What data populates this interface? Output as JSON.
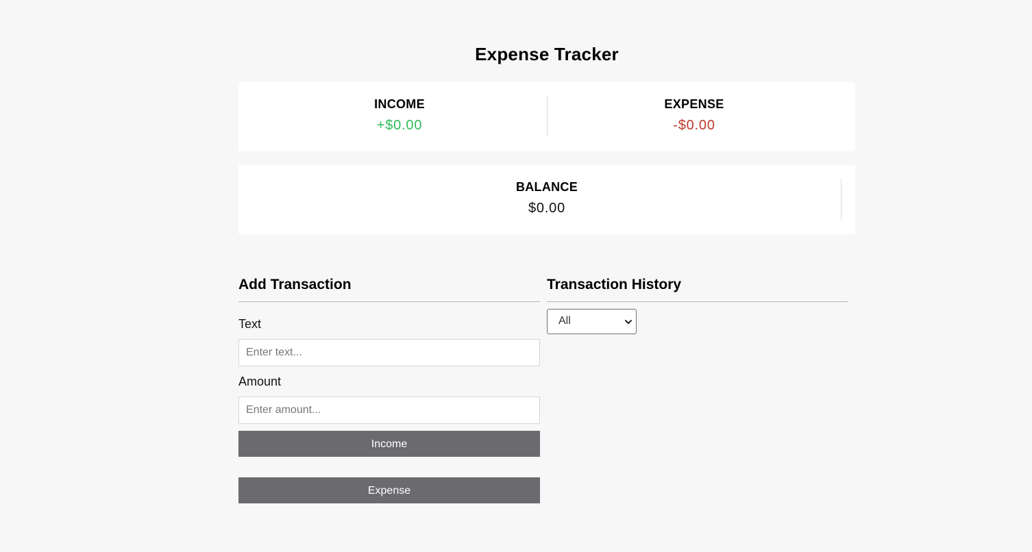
{
  "header": {
    "title": "Expense Tracker"
  },
  "summary": {
    "income_label": "INCOME",
    "income_value": "+$0.00",
    "expense_label": "EXPENSE",
    "expense_value": "-$0.00",
    "balance_label": "BALANCE",
    "balance_value": "$0.00"
  },
  "add_transaction": {
    "title": "Add Transaction",
    "text_label": "Text",
    "text_placeholder": "Enter text...",
    "text_value": "",
    "amount_label": "Amount",
    "amount_placeholder": "Enter amount...",
    "amount_value": "",
    "income_button": "Income",
    "expense_button": "Expense"
  },
  "history": {
    "title": "Transaction History",
    "filter_selected": "All"
  },
  "colors": {
    "background": "#f7f7f7",
    "card": "#ffffff",
    "income": "#2ebc5b",
    "expense": "#c0392b",
    "button": "#6b6b6f"
  },
  "icons": {
    "filter_dropdown": "chevron-down-icon"
  }
}
